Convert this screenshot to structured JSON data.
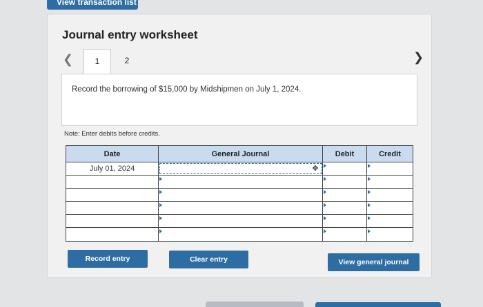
{
  "top_button": {
    "label": "View transaction list"
  },
  "worksheet": {
    "title": "Journal entry worksheet",
    "tabs": [
      {
        "label": "1"
      },
      {
        "label": "2"
      }
    ],
    "prompt": "Record the borrowing of $15,000 by Midshipmen on July 1, 2024.",
    "note": "Note: Enter debits before credits."
  },
  "table": {
    "headers": {
      "date": "Date",
      "general_journal": "General Journal",
      "debit": "Debit",
      "credit": "Credit"
    },
    "rows": [
      {
        "date": "July 01, 2024",
        "general_journal": "",
        "debit": "",
        "credit": ""
      },
      {
        "date": "",
        "general_journal": "",
        "debit": "",
        "credit": ""
      },
      {
        "date": "",
        "general_journal": "",
        "debit": "",
        "credit": ""
      },
      {
        "date": "",
        "general_journal": "",
        "debit": "",
        "credit": ""
      },
      {
        "date": "",
        "general_journal": "",
        "debit": "",
        "credit": ""
      },
      {
        "date": "",
        "general_journal": "",
        "debit": "",
        "credit": ""
      }
    ]
  },
  "buttons": {
    "record": "Record entry",
    "clear": "Clear entry",
    "view": "View general journal"
  },
  "icons": {
    "prev": "chevron-left-icon",
    "next": "chevron-right-icon",
    "cursor": "move-cursor-icon"
  },
  "colors": {
    "accent": "#2e6da4",
    "header_bg": "#c9dcef",
    "panel_bg": "#f1f1f1"
  }
}
